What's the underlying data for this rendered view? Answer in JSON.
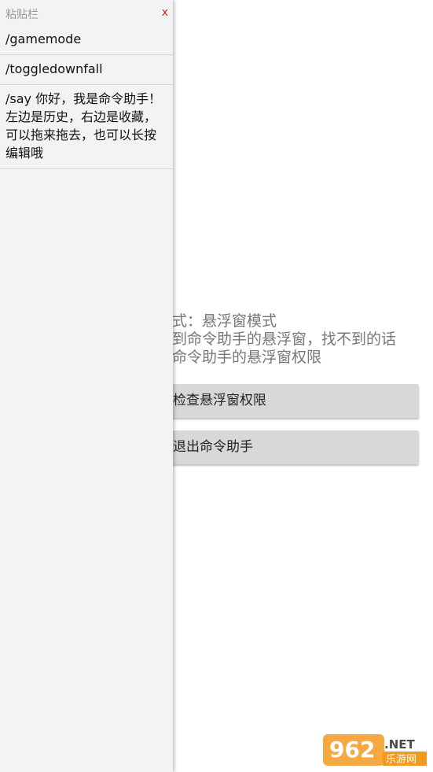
{
  "main": {
    "status_lines": [
      "模式：悬浮窗模式",
      "找到命令助手的悬浮窗，找不到的话",
      "开命令助手的悬浮窗权限"
    ],
    "check_button_label": "检查悬浮窗权限",
    "exit_button_label": "退出命令助手"
  },
  "clipboard": {
    "title": "粘贴栏",
    "close_label": "x",
    "items": [
      "/gamemode",
      "/toggledownfall",
      "/say 你好，我是命令助手！左边是历史，右边是收藏，可以拖来拖去，也可以长按编辑哦"
    ]
  },
  "watermark": {
    "logo_text": "962",
    "net_text": ".NET",
    "sub_text": "乐游网"
  },
  "colors": {
    "panel_bg": "#f3f3f3",
    "button_bg": "#d8d8d8",
    "close_red": "#e02020",
    "logo_orange": "#f39a1e"
  }
}
